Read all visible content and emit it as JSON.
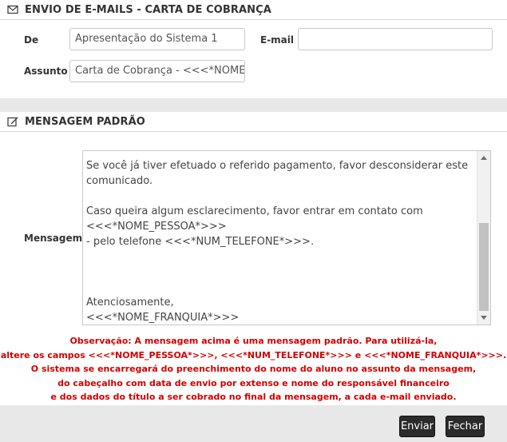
{
  "email_panel": {
    "title": "ENVIO DE E-MAILS - CARTA DE COBRANÇA",
    "icon": "envelope-icon",
    "de_label": "De",
    "de_value": "Apresentação do Sistema 1",
    "email_label": "E-mail",
    "email_value": "",
    "assunto_label": "Assunto",
    "assunto_value": "Carta de Cobrança - <<<*NOME_"
  },
  "message_panel": {
    "title": "MENSAGEM PADRÃO",
    "icon": "edit-icon",
    "mensagem_label": "Mensagem",
    "mensagem_text": "Se você já tiver efetuado o referido pagamento, favor desconsiderar este\ncomunicado.\n\nCaso queira algum esclarecimento, favor entrar em contato com\n<<<*NOME_PESSOA*>>>\n- pelo telefone <<<*NUM_TELEFONE*>>>.\n\n\n\nAtenciosamente,\n<<<*NOME_FRANQUIA*>>>",
    "observacao": [
      "Observação: A mensagem acima é uma mensagem padrão. Para utilizá-la,",
      "altere os campos <<<*NOME_PESSOA*>>>, <<<*NUM_TELEFONE*>>> e <<<*NOME_FRANQUIA*>>>.",
      "O sistema se encarregará do preenchimento do nome do aluno no assunto da mensagem,",
      "do cabeçalho com data de envio por extenso e nome do responsável financeiro",
      "e dos dados do título a ser cobrado no final da mensagem, a cada e-mail enviado."
    ]
  },
  "actions": {
    "enviar_label": "Enviar",
    "fechar_label": "Fechar"
  },
  "colors": {
    "observacao_text": "#d40000",
    "button_bg": "#2b2b2b"
  }
}
